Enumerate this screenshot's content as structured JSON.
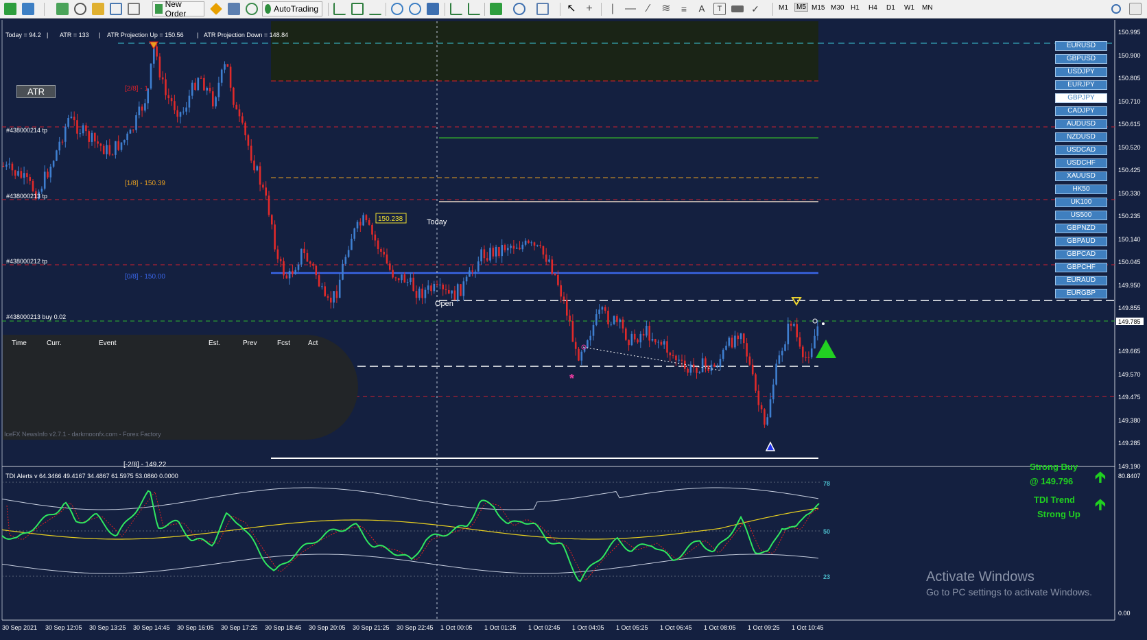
{
  "toolbar": {
    "new_order_label": "New Order",
    "autotrading_label": "AutoTrading",
    "timeframes": [
      "M1",
      "M5",
      "M15",
      "M30",
      "H1",
      "H4",
      "D1",
      "W1",
      "MN"
    ],
    "active_timeframe": "M5"
  },
  "info_line": {
    "today": "Today = 94.2",
    "atr": "ATR = 133",
    "proj_up": "ATR Projection Up = 150.56",
    "proj_down": "ATR Projection Down = 148.84"
  },
  "atr_button": "ATR",
  "price_axis": {
    "labels": [
      "150.995",
      "150.900",
      "150.805",
      "150.710",
      "150.615",
      "150.520",
      "150.425",
      "150.330",
      "150.235",
      "150.140",
      "150.045",
      "149.950",
      "149.855",
      "149.785",
      "149.665",
      "149.570",
      "149.475",
      "149.380",
      "149.285",
      "149.190"
    ],
    "current_price": "149.785"
  },
  "time_axis": {
    "labels": [
      "30 Sep 2021",
      "30 Sep 12:05",
      "30 Sep 13:25",
      "30 Sep 14:45",
      "30 Sep 16:05",
      "30 Sep 17:25",
      "30 Sep 18:45",
      "30 Sep 20:05",
      "30 Sep 21:25",
      "30 Sep 22:45",
      "1 Oct 00:05",
      "1 Oct 01:25",
      "1 Oct 02:45",
      "1 Oct 04:05",
      "1 Oct 05:25",
      "1 Oct 06:45",
      "1 Oct 08:05",
      "1 Oct 09:25",
      "1 Oct 10:45"
    ]
  },
  "level_labels": {
    "murrey_2_8": "[2/8] - 1",
    "murrey_1_8": "[1/8] - 150.39",
    "murrey_0_8": "[0/8] - 150.00",
    "murrey_m2_8": "[-2/8] - 149.22",
    "tp_214": "#438000214 tp",
    "tp_213": "#438000213 tp",
    "tp_212": "#438000212 tp",
    "buy": "#438000213 buy 0.02",
    "price_tag": "150.238",
    "today": "Today",
    "open": "Open"
  },
  "symbols": [
    "EURUSD",
    "GBPUSD",
    "USDJPY",
    "EURJPY",
    "GBPJPY",
    "CADJPY",
    "AUDUSD",
    "NZDUSD",
    "USDCAD",
    "USDCHF",
    "XAUUSD",
    "HK50",
    "UK100",
    "US500",
    "GBPNZD",
    "GBPAUD",
    "GBPCAD",
    "GBPCHF",
    "EURAUD",
    "EURGBP"
  ],
  "selected_symbol": "GBPJPY",
  "news_panel": {
    "headers": [
      "Time",
      "Curr.",
      "Event",
      "Est.",
      "Prev",
      "Fcst",
      "Act"
    ],
    "footer": "IceFX NewsInfo v2.7.1 - darkmoonfx.com - Forex Factory"
  },
  "indicator": {
    "title": "TDI Alerts v 64.3466 49.4167 34.4867 61.5975 53.0860 0.0000",
    "levels": [
      "78",
      "50",
      "23"
    ],
    "axis_top": "80.8407",
    "axis_bottom": "0.00",
    "signal_line1": "Strong Buy",
    "signal_line2": "@ 149.796",
    "trend_line1": "TDI Trend",
    "trend_line2": "Strong Up"
  },
  "watermark": {
    "line1": "Activate Windows",
    "line2": "Go to PC settings to activate Windows."
  }
}
